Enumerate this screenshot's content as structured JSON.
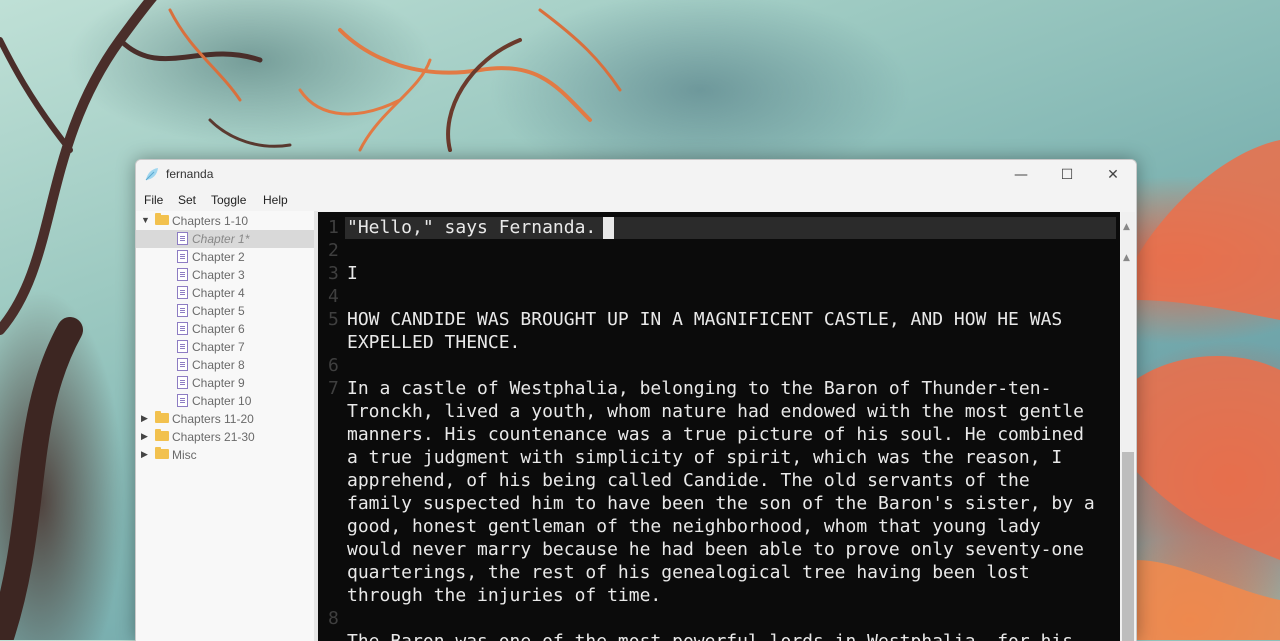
{
  "window": {
    "title": "fernanda",
    "controls": {
      "minimize": "—",
      "maximize": "☐",
      "close": "✕"
    }
  },
  "menu": [
    "File",
    "Set",
    "Toggle",
    "Help"
  ],
  "sidebar": {
    "tree": [
      {
        "type": "folder",
        "label": "Chapters 1-10",
        "expanded": true
      },
      {
        "type": "file",
        "label": "Chapter 1*",
        "selected": true
      },
      {
        "type": "file",
        "label": "Chapter 2"
      },
      {
        "type": "file",
        "label": "Chapter 3"
      },
      {
        "type": "file",
        "label": "Chapter 4"
      },
      {
        "type": "file",
        "label": "Chapter 5"
      },
      {
        "type": "file",
        "label": "Chapter 6"
      },
      {
        "type": "file",
        "label": "Chapter 7"
      },
      {
        "type": "file",
        "label": "Chapter 8"
      },
      {
        "type": "file",
        "label": "Chapter 9"
      },
      {
        "type": "file",
        "label": "Chapter 10"
      },
      {
        "type": "folder",
        "label": "Chapters 11-20",
        "expanded": false
      },
      {
        "type": "folder",
        "label": "Chapters 21-30",
        "expanded": false
      },
      {
        "type": "folder",
        "label": "Misc",
        "expanded": false
      }
    ]
  },
  "editor": {
    "line_numbers": [
      "1",
      "2",
      "3",
      "4",
      "5",
      "6",
      "7",
      "8"
    ],
    "lines": [
      "\"Hello,\" says Fernanda.",
      "",
      "I",
      "",
      "HOW CANDIDE WAS BROUGHT UP IN A MAGNIFICENT CASTLE, AND HOW HE WAS",
      "EXPELLED THENCE.",
      "",
      "In a castle of Westphalia, belonging to the Baron of Thunder-ten-",
      "Tronckh, lived a youth, whom nature had endowed with the most gentle",
      "manners. His countenance was a true picture of his soul. He combined",
      "a true judgment with simplicity of spirit, which was the reason, I",
      "apprehend, of his being called Candide. The old servants of the",
      "family suspected him to have been the son of the Baron's sister, by a",
      "good, honest gentleman of the neighborhood, whom that young lady",
      "would never marry because he had been able to prove only seventy-one",
      "quarterings, the rest of his genealogical tree having been lost",
      "through the injuries of time.",
      "",
      "The Baron was one of the most powerful lords in Westphalia, for his"
    ]
  },
  "colors": {
    "editor_bg": "#0b0b0b",
    "editor_text": "#e9e9e9",
    "gutter_text": "#3f3f3f",
    "current_line": "#2b2b2b",
    "folder": "#f2c14e",
    "file_icon": "#8d7cc3"
  },
  "icons": {
    "app": "feather-icon",
    "folder": "folder-icon",
    "file": "document-icon",
    "expand": "chevron-right-icon",
    "collapse": "chevron-down-icon"
  }
}
